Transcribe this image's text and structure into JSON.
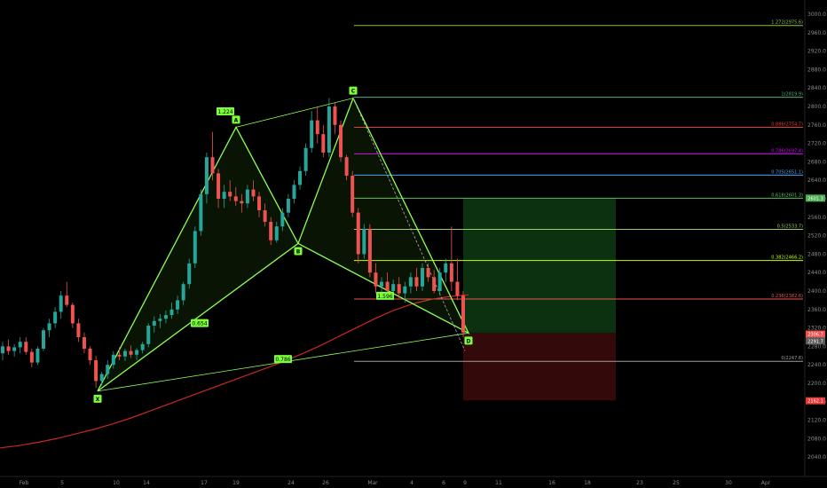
{
  "chart_data": {
    "type": "candlestick",
    "symbol_ylim": [
      2000,
      3020
    ],
    "y_ticks": [
      "3000.0",
      "2960.0",
      "2920.0",
      "2880.0",
      "2840.0",
      "2800.0",
      "2760.0",
      "2720.0",
      "2680.0",
      "2640.0",
      "2600.0",
      "2560.0",
      "2520.0",
      "2480.0",
      "2440.0",
      "2400.0",
      "2360.0",
      "2320.0",
      "2280.0",
      "2240.0",
      "2200.0",
      "2160.0",
      "2120.0",
      "2080.0",
      "2040.0"
    ],
    "x_ticks": [
      "Feb",
      "5",
      "10",
      "14",
      "17",
      "19",
      "24",
      "26",
      "Mar",
      "4",
      "6",
      "9",
      "11",
      "16",
      "18",
      "23",
      "25",
      "30",
      "Apr"
    ],
    "pattern": {
      "points": [
        {
          "label": "X",
          "price": 2183
        },
        {
          "label": "A",
          "price": 2755
        },
        {
          "label": "B",
          "price": 2503
        },
        {
          "label": "C",
          "price": 2818
        },
        {
          "label": "D",
          "price": 2309
        }
      ],
      "ratios": [
        "1.224",
        "0.786",
        "1.596",
        "0.654"
      ]
    },
    "fib_levels": [
      {
        "label": "1.272(2975.6)",
        "price": 2975.6,
        "color": "#8bc34a"
      },
      {
        "label": "1(2819.9)",
        "price": 2819.9,
        "color": "#4caf7a"
      },
      {
        "label": "0.886(2754.7)",
        "price": 2754.7,
        "color": "#e53935"
      },
      {
        "label": "0.786(2697.4)",
        "price": 2697.4,
        "color": "#d500f9"
      },
      {
        "label": "0.705(2651.1)",
        "price": 2651.1,
        "color": "#42a5f5"
      },
      {
        "label": "0.618(2601.3)",
        "price": 2601.3,
        "color": "#66bb6a"
      },
      {
        "label": "0.5(2533.7)",
        "price": 2533.7,
        "color": "#9ccc65"
      },
      {
        "label": "0.382(2466.2)",
        "price": 2466.2,
        "color": "#c6ff00"
      },
      {
        "label": "0.236(2382.6)",
        "price": 2382.6,
        "color": "#ef5350"
      },
      {
        "label": "0(2247.6)",
        "price": 2247.6,
        "color": "#9e9e9e"
      }
    ],
    "price_badges": [
      {
        "label": "2601.3",
        "color": "#4caf50"
      },
      {
        "label": "2306.7",
        "color": "#ef5350"
      },
      {
        "label": "2291.7",
        "color": "#5a5a5a"
      },
      {
        "label": "2162.1",
        "color": "#e53935"
      }
    ],
    "position": {
      "entry": 2309,
      "target": 2601,
      "stop": 2163
    },
    "series": [
      {
        "name": "",
        "type": "candles",
        "ohlc": [
          [
            2265,
            2290,
            2250,
            2280
          ],
          [
            2280,
            2295,
            2262,
            2270
          ],
          [
            2270,
            2285,
            2258,
            2278
          ],
          [
            2278,
            2300,
            2265,
            2290
          ],
          [
            2290,
            2300,
            2262,
            2268
          ],
          [
            2268,
            2275,
            2235,
            2245
          ],
          [
            2245,
            2280,
            2240,
            2275
          ],
          [
            2275,
            2320,
            2270,
            2315
          ],
          [
            2315,
            2340,
            2300,
            2330
          ],
          [
            2330,
            2365,
            2320,
            2355
          ],
          [
            2355,
            2400,
            2340,
            2390
          ],
          [
            2390,
            2420,
            2365,
            2370
          ],
          [
            2370,
            2375,
            2320,
            2330
          ],
          [
            2330,
            2340,
            2290,
            2300
          ],
          [
            2300,
            2310,
            2265,
            2275
          ],
          [
            2275,
            2280,
            2240,
            2250
          ],
          [
            2250,
            2260,
            2190,
            2205
          ],
          [
            2205,
            2225,
            2195,
            2220
          ],
          [
            2220,
            2250,
            2210,
            2240
          ],
          [
            2240,
            2270,
            2232,
            2262
          ],
          [
            2262,
            2278,
            2250,
            2258
          ],
          [
            2258,
            2275,
            2248,
            2270
          ],
          [
            2270,
            2282,
            2255,
            2262
          ],
          [
            2262,
            2276,
            2250,
            2272
          ],
          [
            2272,
            2290,
            2265,
            2285
          ],
          [
            2285,
            2330,
            2278,
            2325
          ],
          [
            2325,
            2345,
            2310,
            2335
          ],
          [
            2335,
            2350,
            2320,
            2340
          ],
          [
            2340,
            2358,
            2330,
            2348
          ],
          [
            2348,
            2375,
            2340,
            2360
          ],
          [
            2360,
            2390,
            2350,
            2380
          ],
          [
            2380,
            2420,
            2370,
            2415
          ],
          [
            2415,
            2470,
            2405,
            2460
          ],
          [
            2460,
            2540,
            2450,
            2530
          ],
          [
            2530,
            2620,
            2520,
            2610
          ],
          [
            2610,
            2700,
            2590,
            2690
          ],
          [
            2690,
            2745,
            2640,
            2655
          ],
          [
            2655,
            2665,
            2580,
            2600
          ],
          [
            2600,
            2630,
            2580,
            2615
          ],
          [
            2615,
            2640,
            2595,
            2605
          ],
          [
            2605,
            2625,
            2585,
            2595
          ],
          [
            2595,
            2610,
            2570,
            2590
          ],
          [
            2590,
            2630,
            2580,
            2620
          ],
          [
            2620,
            2640,
            2595,
            2605
          ],
          [
            2605,
            2615,
            2560,
            2575
          ],
          [
            2575,
            2590,
            2540,
            2550
          ],
          [
            2550,
            2560,
            2500,
            2510
          ],
          [
            2510,
            2550,
            2505,
            2540
          ],
          [
            2540,
            2580,
            2530,
            2570
          ],
          [
            2570,
            2610,
            2560,
            2600
          ],
          [
            2600,
            2640,
            2590,
            2630
          ],
          [
            2630,
            2670,
            2620,
            2660
          ],
          [
            2660,
            2720,
            2650,
            2710
          ],
          [
            2710,
            2790,
            2700,
            2770
          ],
          [
            2770,
            2800,
            2720,
            2740
          ],
          [
            2740,
            2760,
            2690,
            2700
          ],
          [
            2700,
            2818,
            2690,
            2800
          ],
          [
            2800,
            2810,
            2740,
            2760
          ],
          [
            2760,
            2770,
            2680,
            2690
          ],
          [
            2690,
            2695,
            2640,
            2650
          ],
          [
            2650,
            2660,
            2560,
            2570
          ],
          [
            2570,
            2580,
            2460,
            2480
          ],
          [
            2480,
            2545,
            2470,
            2535
          ],
          [
            2535,
            2545,
            2430,
            2440
          ],
          [
            2440,
            2460,
            2395,
            2410
          ],
          [
            2410,
            2430,
            2385,
            2420
          ],
          [
            2420,
            2440,
            2390,
            2400
          ],
          [
            2400,
            2425,
            2380,
            2415
          ],
          [
            2415,
            2430,
            2385,
            2395
          ],
          [
            2395,
            2420,
            2375,
            2410
          ],
          [
            2410,
            2440,
            2395,
            2430
          ],
          [
            2430,
            2450,
            2400,
            2410
          ],
          [
            2410,
            2460,
            2400,
            2450
          ],
          [
            2450,
            2460,
            2420,
            2430
          ],
          [
            2430,
            2445,
            2395,
            2400
          ],
          [
            2400,
            2450,
            2390,
            2440
          ],
          [
            2440,
            2470,
            2420,
            2460
          ],
          [
            2460,
            2540,
            2400,
            2420
          ],
          [
            2420,
            2470,
            2380,
            2390
          ],
          [
            2390,
            2400,
            2300,
            2310
          ]
        ]
      },
      {
        "name": "",
        "type": "ma",
        "color": "#c62828",
        "values": [
          2060,
          2065,
          2072,
          2080,
          2090,
          2100,
          2112,
          2125,
          2140,
          2155,
          2170,
          2185,
          2200,
          2215,
          2230,
          2245,
          2262,
          2280,
          2300,
          2320,
          2340,
          2358,
          2372,
          2382,
          2388,
          2392
        ]
      }
    ]
  }
}
